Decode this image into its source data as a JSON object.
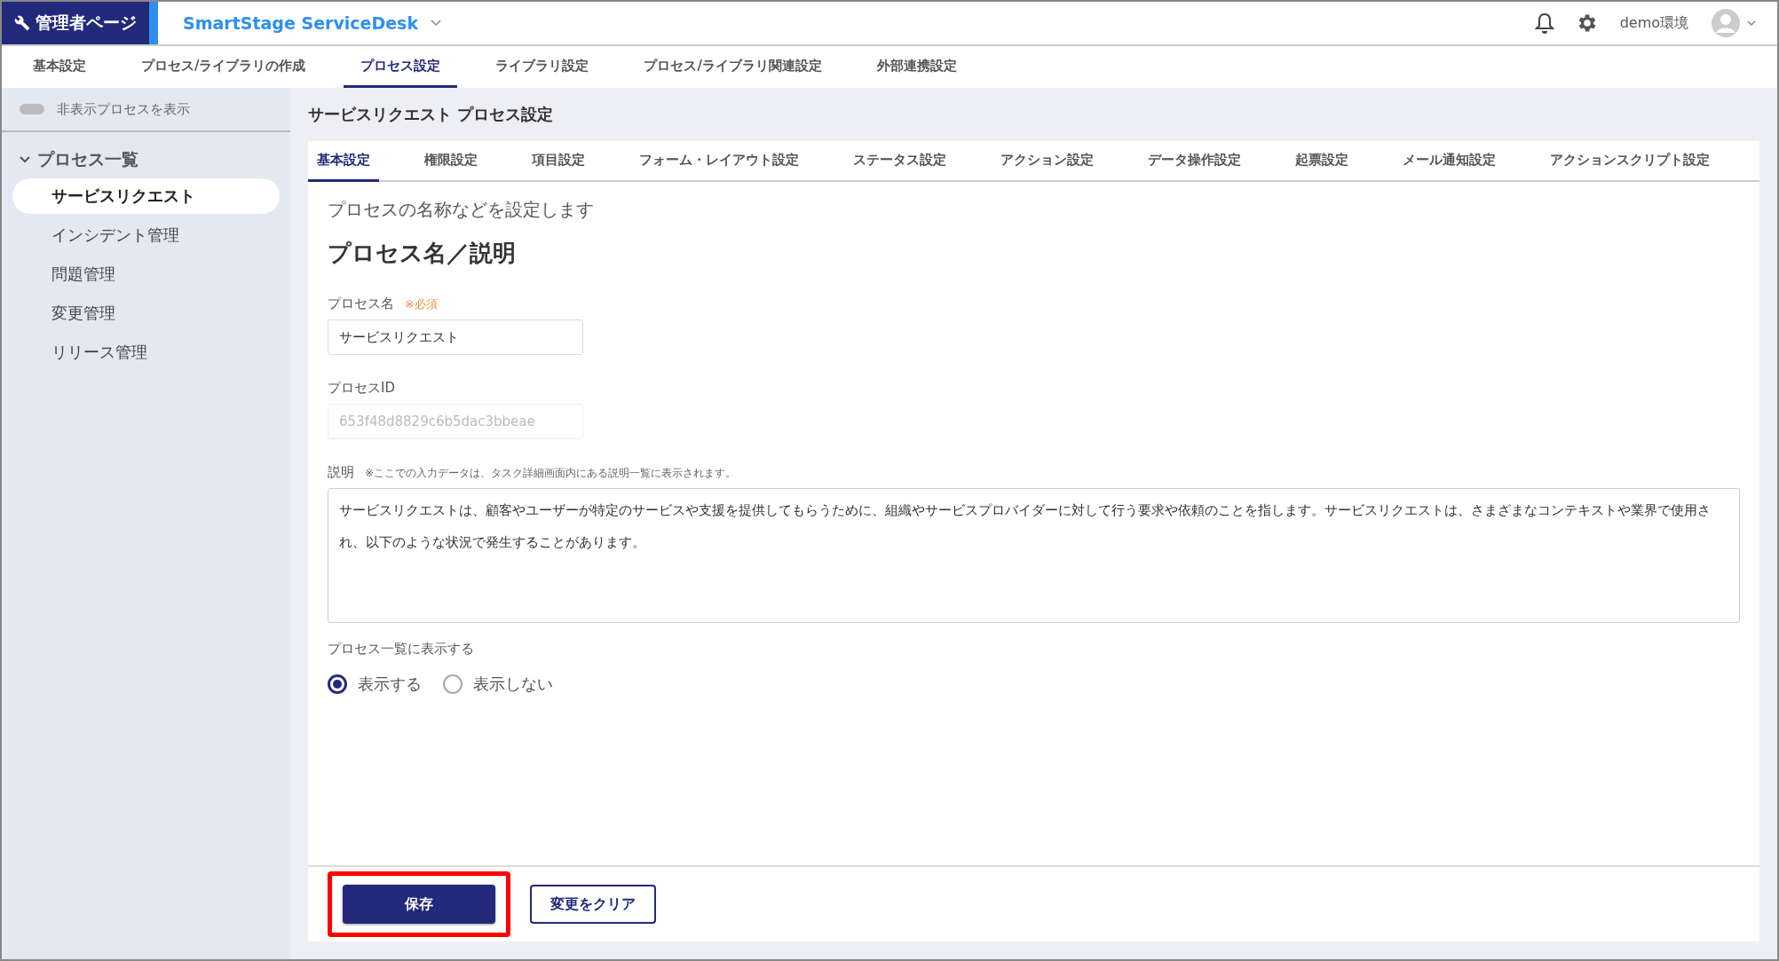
{
  "header": {
    "badge": "管理者ページ",
    "app_name": "SmartStage ServiceDesk",
    "user": "demo環境"
  },
  "nav_tabs": [
    {
      "label": "基本設定",
      "selected": false
    },
    {
      "label": "プロセス/ライブラリの作成",
      "selected": false
    },
    {
      "label": "プロセス設定",
      "selected": true
    },
    {
      "label": "ライブラリ設定",
      "selected": false
    },
    {
      "label": "プロセス/ライブラリ関連設定",
      "selected": false
    },
    {
      "label": "外部連携設定",
      "selected": false
    }
  ],
  "sidebar": {
    "toggle": {
      "label": "非表示プロセスを表示",
      "on": false
    },
    "group": {
      "label": "プロセス一覧",
      "expanded": true
    },
    "items": [
      {
        "label": "サービスリクエスト",
        "selected": true
      },
      {
        "label": "インシデント管理",
        "selected": false
      },
      {
        "label": "問題管理",
        "selected": false
      },
      {
        "label": "変更管理",
        "selected": false
      },
      {
        "label": "リリース管理",
        "selected": false
      }
    ]
  },
  "page_title": "サービスリクエスト プロセス設定",
  "tabs": [
    {
      "label": "基本設定",
      "selected": true
    },
    {
      "label": "権限設定",
      "selected": false
    },
    {
      "label": "項目設定",
      "selected": false
    },
    {
      "label": "フォーム・レイアウト設定",
      "selected": false
    },
    {
      "label": "ステータス設定",
      "selected": false
    },
    {
      "label": "アクション設定",
      "selected": false
    },
    {
      "label": "データ操作設定",
      "selected": false
    },
    {
      "label": "起票設定",
      "selected": false
    },
    {
      "label": "メール通知設定",
      "selected": false
    },
    {
      "label": "アクションスクリプト設定",
      "selected": false
    }
  ],
  "intro": "プロセスの名称などを設定します",
  "section_title": "プロセス名／説明",
  "fields": {
    "name": {
      "label": "プロセス名",
      "required": "※必須",
      "value": "サービスリクエスト"
    },
    "id": {
      "label": "プロセスID",
      "value": "653f48d8829c6b5dac3bbeae",
      "disabled": true
    },
    "description": {
      "label": "説明",
      "note": "※ここでの入力データは、タスク詳細画面内にある説明一覧に表示されます。",
      "value": "サービスリクエストは、顧客やユーザーが特定のサービスや支援を提供してもらうために、組織やサービスプロバイダーに対して行う要求や依頼のことを指します。サービスリクエストは、さまざまなコンテキストや業界で使用され、以下のような状況で発生することがあります。"
    }
  },
  "visibility": {
    "label": "プロセス一覧に表示する",
    "options": [
      {
        "label": "表示する",
        "selected": true
      },
      {
        "label": "表示しない",
        "selected": false
      }
    ]
  },
  "buttons": [
    {
      "label": "保存",
      "kind": "primary",
      "highlighted": true
    },
    {
      "label": "変更をクリア",
      "kind": "secondary",
      "highlighted": false
    }
  ]
}
